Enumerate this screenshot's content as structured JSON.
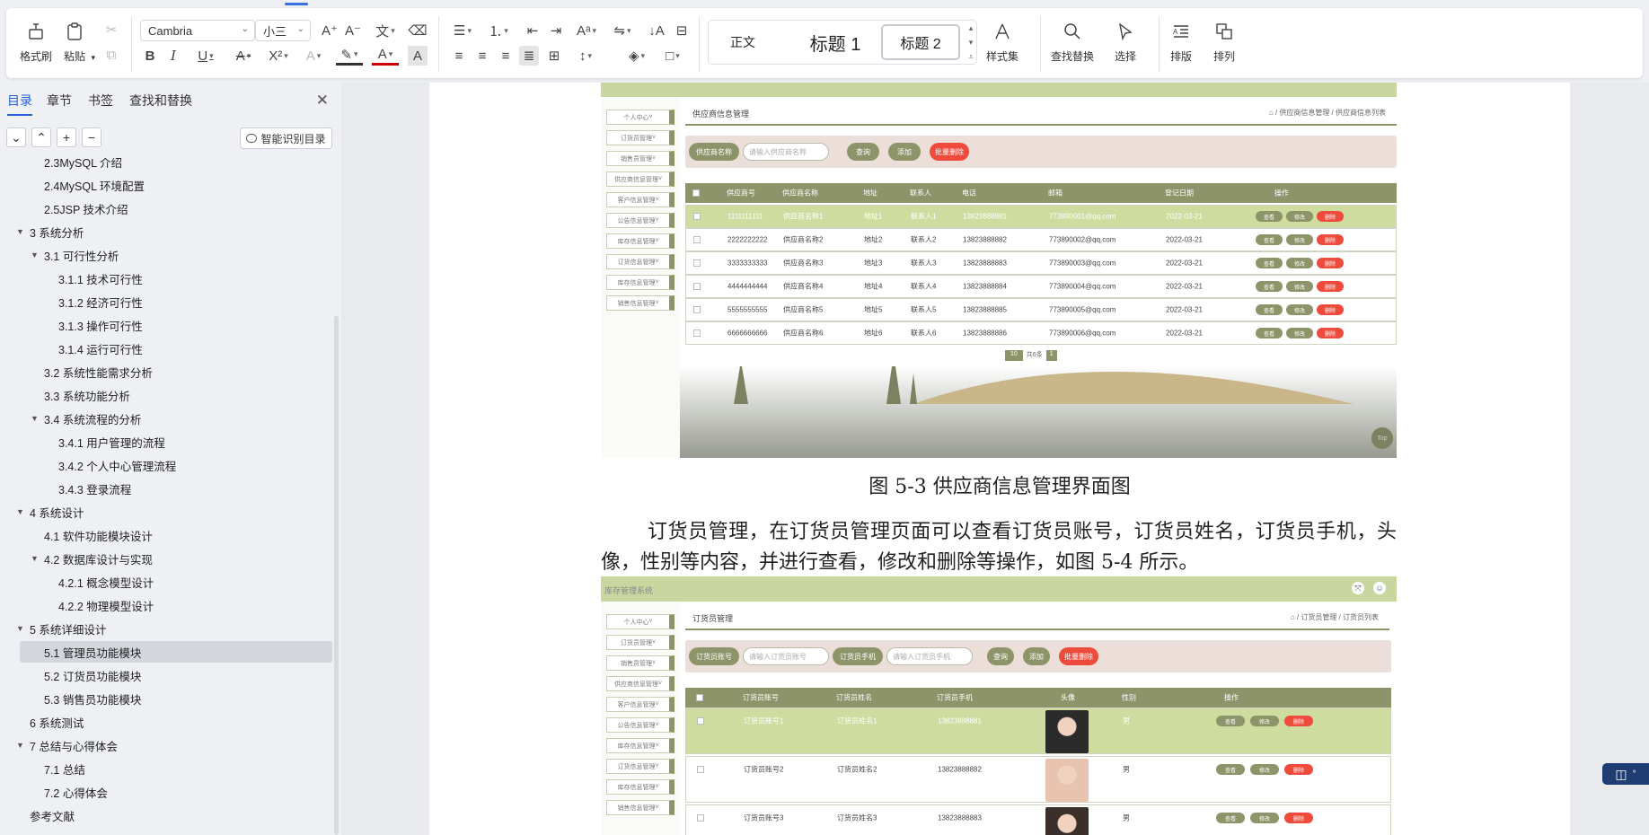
{
  "ribbon": {
    "format_painter": "格式刷",
    "paste": "粘贴",
    "font_name": "Cambria",
    "font_size": "小三",
    "styles": {
      "normal": "正文",
      "heading1": "标题 1",
      "heading2": "标题 2"
    },
    "style_set": "样式集",
    "find_replace": "查找替换",
    "select": "选择",
    "typeset": "排版",
    "arrange": "排列"
  },
  "nav": {
    "tabs": [
      "目录",
      "章节",
      "书签",
      "查找和替换"
    ],
    "smart_toc": "智能识别目录",
    "items": [
      {
        "label": "2.3MySQL 介绍",
        "level": 2,
        "tri": ""
      },
      {
        "label": "2.4MySQL 环境配置",
        "level": 2,
        "tri": ""
      },
      {
        "label": "2.5JSP 技术介绍",
        "level": 2,
        "tri": ""
      },
      {
        "label": "3 系统分析",
        "level": 1,
        "tri": "▼"
      },
      {
        "label": "3.1 可行性分析",
        "level": 2,
        "tri": "▼"
      },
      {
        "label": "3.1.1 技术可行性",
        "level": 3,
        "tri": ""
      },
      {
        "label": "3.1.2 经济可行性",
        "level": 3,
        "tri": ""
      },
      {
        "label": "3.1.3 操作可行性",
        "level": 3,
        "tri": ""
      },
      {
        "label": "3.1.4  运行可行性",
        "level": 3,
        "tri": ""
      },
      {
        "label": "3.2 系统性能需求分析",
        "level": 2,
        "tri": ""
      },
      {
        "label": "3.3 系统功能分析",
        "level": 2,
        "tri": ""
      },
      {
        "label": "3.4 系统流程的分析",
        "level": 2,
        "tri": "▼"
      },
      {
        "label": "3.4.1  用户管理的流程",
        "level": 3,
        "tri": ""
      },
      {
        "label": "3.4.2 个人中心管理流程",
        "level": 3,
        "tri": ""
      },
      {
        "label": "3.4.3 登录流程",
        "level": 3,
        "tri": ""
      },
      {
        "label": "4 系统设计",
        "level": 1,
        "tri": "▼"
      },
      {
        "label": "4.1  软件功能模块设计",
        "level": 2,
        "tri": ""
      },
      {
        "label": "4.2 数据库设计与实现",
        "level": 2,
        "tri": "▼"
      },
      {
        "label": "4.2.1 概念模型设计",
        "level": 3,
        "tri": ""
      },
      {
        "label": "4.2.2 物理模型设计",
        "level": 3,
        "tri": ""
      },
      {
        "label": "5 系统详细设计",
        "level": 1,
        "tri": "▼"
      },
      {
        "label": "5.1 管理员功能模块",
        "level": 2,
        "tri": "",
        "selected": true
      },
      {
        "label": "5.2 订货员功能模块",
        "level": 2,
        "tri": ""
      },
      {
        "label": "5.3 销售员功能模块",
        "level": 2,
        "tri": ""
      },
      {
        "label": "6 系统测试",
        "level": 1,
        "tri": ""
      },
      {
        "label": "7 总结与心得体会",
        "level": 1,
        "tri": "▼"
      },
      {
        "label": "7.1  总结",
        "level": 2,
        "tri": ""
      },
      {
        "label": "7.2  心得体会",
        "level": 2,
        "tri": ""
      },
      {
        "label": "参考文献",
        "level": 1,
        "tri": ""
      }
    ]
  },
  "doc": {
    "figure1": {
      "sidebar": [
        "个人中心",
        "订货员管理",
        "销售员管理",
        "供应商信息管理",
        "客户信息管理",
        "公告信息管理",
        "库存信息管理",
        "订货信息管理",
        "库存信息管理",
        "销售信息管理"
      ],
      "page_title": "供应商信息管理",
      "breadcrumb": "⌂ / 供应商信息管理 / 供应商信息列表",
      "search_label": "供应商名称",
      "search_placeholder": "请输入供应商名称",
      "btn_query": "查询",
      "btn_add": "添加",
      "btn_batch_delete": "批量删除",
      "columns": [
        "供应商号",
        "供应商名称",
        "地址",
        "联系人",
        "电话",
        "邮箱",
        "登记日期",
        "操作"
      ],
      "rows": [
        [
          "1111111111",
          "供应商名称1",
          "地址1",
          "联系人1",
          "13823888881",
          "773890001@qq.com",
          "2022-03-21"
        ],
        [
          "2222222222",
          "供应商名称2",
          "地址2",
          "联系人2",
          "13823888882",
          "773890002@qq.com",
          "2022-03-21"
        ],
        [
          "3333333333",
          "供应商名称3",
          "地址3",
          "联系人3",
          "13823888883",
          "773890003@qq.com",
          "2022-03-21"
        ],
        [
          "4444444444",
          "供应商名称4",
          "地址4",
          "联系人4",
          "13823888884",
          "773890004@qq.com",
          "2022-03-21"
        ],
        [
          "5555555555",
          "供应商名称5",
          "地址5",
          "联系人5",
          "13823888885",
          "773890005@qq.com",
          "2022-03-21"
        ],
        [
          "6666666666",
          "供应商名称6",
          "地址6",
          "联系人6",
          "13823888886",
          "773890006@qq.com",
          "2022-03-21"
        ]
      ],
      "actions": [
        "查看",
        "修改",
        "删除"
      ],
      "page_size": "10",
      "total": "共6条",
      "page": "1",
      "top": "Top"
    },
    "caption1": "图 5-3 供应商信息管理界面图",
    "paragraph": "订货员管理，在订货员管理页面可以查看订货员账号，订货员姓名，订货员手机，头像，性别等内容，并进行查看，修改和删除等操作，如图 5-4 所示。",
    "figure2": {
      "app_title": "库存管理系统",
      "sidebar": [
        "个人中心",
        "订货员管理",
        "销售员管理",
        "供应商信息管理",
        "客户信息管理",
        "公告信息管理",
        "库存信息管理",
        "订货信息管理",
        "库存信息管理",
        "销售信息管理"
      ],
      "page_title": "订货员管理",
      "breadcrumb": "⌂ / 订货员管理 / 订货员列表",
      "search_label1": "订货员账号",
      "search_placeholder1": "请输入订货员账号",
      "search_label2": "订货员手机",
      "search_placeholder2": "请输入订货员手机",
      "btn_query": "查询",
      "btn_add": "添加",
      "btn_batch_delete": "批量删除",
      "columns": [
        "订货员账号",
        "订货员姓名",
        "订货员手机",
        "头像",
        "性别",
        "操作"
      ],
      "rows": [
        [
          "订货员账号1",
          "订货员姓名1",
          "13823888881",
          "男"
        ],
        [
          "订货员账号2",
          "订货员姓名2",
          "13823888882",
          "男"
        ],
        [
          "订货员账号3",
          "订货员姓名3",
          "13823888883",
          "男"
        ]
      ],
      "actions": [
        "查看",
        "修改",
        "删除"
      ]
    }
  },
  "colors": {
    "accent": "#2461d6",
    "olive": "#8d9469",
    "danger": "#ef4b3c",
    "highlight": "#cfdca0"
  }
}
